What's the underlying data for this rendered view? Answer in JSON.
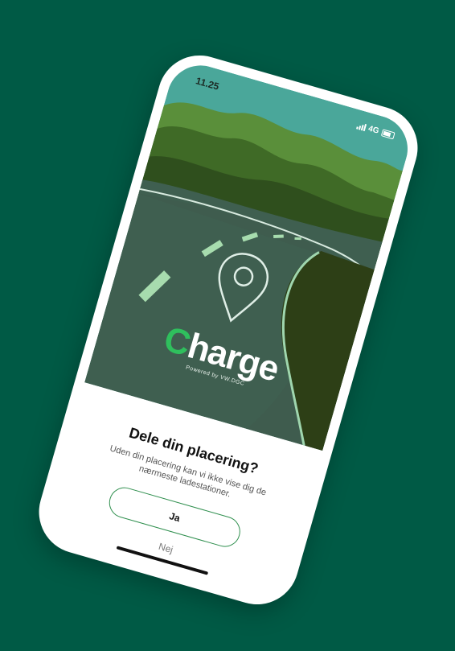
{
  "status_bar": {
    "time": "11.25",
    "network": "4G"
  },
  "brand": {
    "logo_first": "C",
    "logo_rest": "harge",
    "tagline": "Powered by VW.DGC"
  },
  "dialog": {
    "title": "Dele din placering?",
    "body": "Uden din placering kan vi ikke vise dig de nærmeste ladestationer.",
    "yes_label": "Ja",
    "no_label": "Nej"
  },
  "colors": {
    "background": "#005a45",
    "accent": "#2f8f4e",
    "logo_accent": "#2fbf5d"
  }
}
